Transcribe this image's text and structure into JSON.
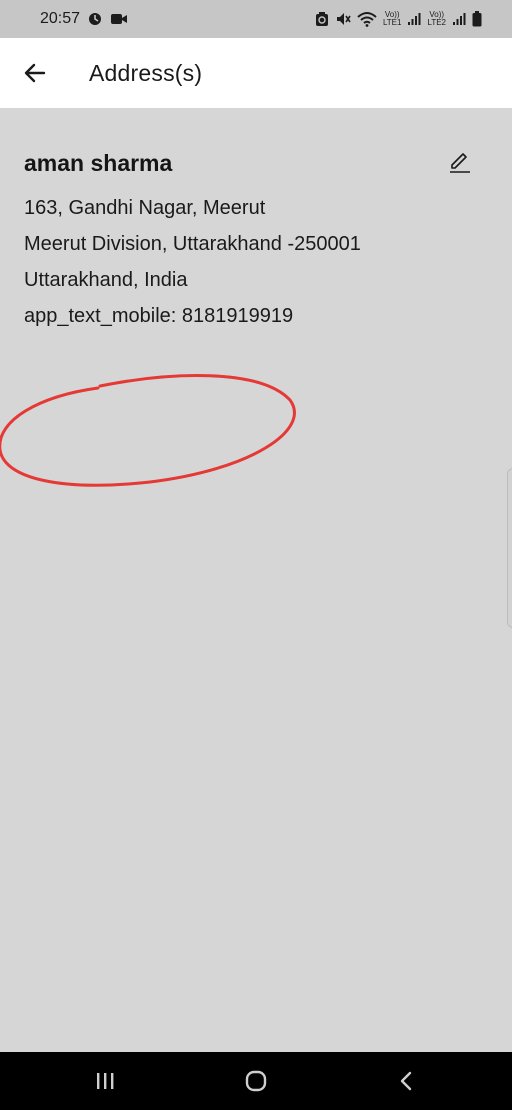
{
  "status_bar": {
    "time": "20:57",
    "sim1_label_top": "Vo))",
    "sim1_label_bottom": "LTE1",
    "sim2_label_top": "Vo))",
    "sim2_label_bottom": "LTE2"
  },
  "app_bar": {
    "title": "Address(s)"
  },
  "address": {
    "name": "aman sharma",
    "line1": "163, Gandhi Nagar, Meerut",
    "line2": "Meerut Division, Uttarakhand -250001",
    "line3": "Uttarakhand, India",
    "mobile": "app_text_mobile: 8181919919"
  },
  "icons": {
    "back": "arrow-left-icon",
    "edit": "pencil-icon",
    "recents": "recent-apps-icon",
    "home": "home-icon",
    "nav_back": "chevron-left-icon"
  },
  "colors": {
    "status_bar": "#c6c6c6",
    "app_bar": "#ffffff",
    "content_bg": "#d6d6d6",
    "annotation": "#e53935",
    "nav_bar": "#000000"
  }
}
